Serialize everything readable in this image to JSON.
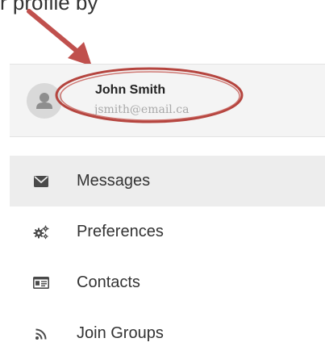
{
  "top_text": "r profile by",
  "profile": {
    "name": "John Smith",
    "email": "jsmith@email.ca",
    "avatar_icon": "user-icon"
  },
  "menu": {
    "items": [
      {
        "label": "Messages",
        "icon": "envelope-icon",
        "active": true
      },
      {
        "label": "Preferences",
        "icon": "gears-icon",
        "active": false
      },
      {
        "label": "Contacts",
        "icon": "contact-card-icon",
        "active": false
      },
      {
        "label": "Join Groups",
        "icon": "rss-icon",
        "active": false
      }
    ]
  },
  "colors": {
    "annotation": "#b5453f",
    "icon": "#4a4a4a",
    "active_bg": "#ededed",
    "panel_bg": "#f4f4f4"
  }
}
